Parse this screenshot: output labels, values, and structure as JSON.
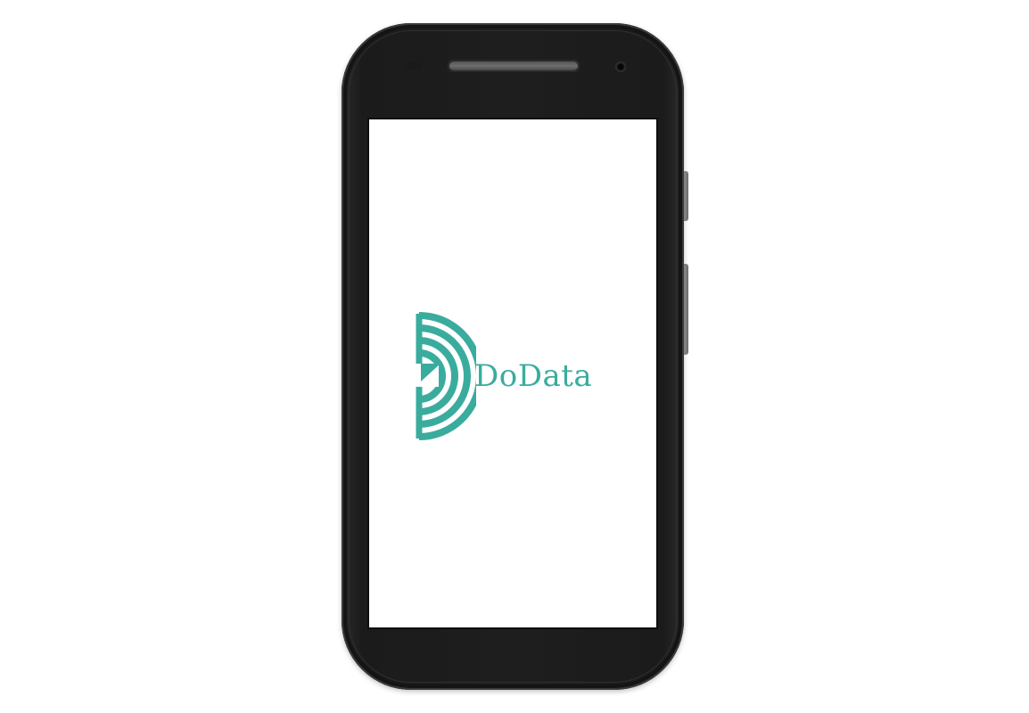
{
  "device": {
    "type": "smartphone",
    "body_color": "#1e1e1e",
    "screen_color": "#ffffff"
  },
  "splash": {
    "app_name": "DoData",
    "brand_color": "#3aac9e",
    "logo_icon": "dodata-logo-icon"
  }
}
